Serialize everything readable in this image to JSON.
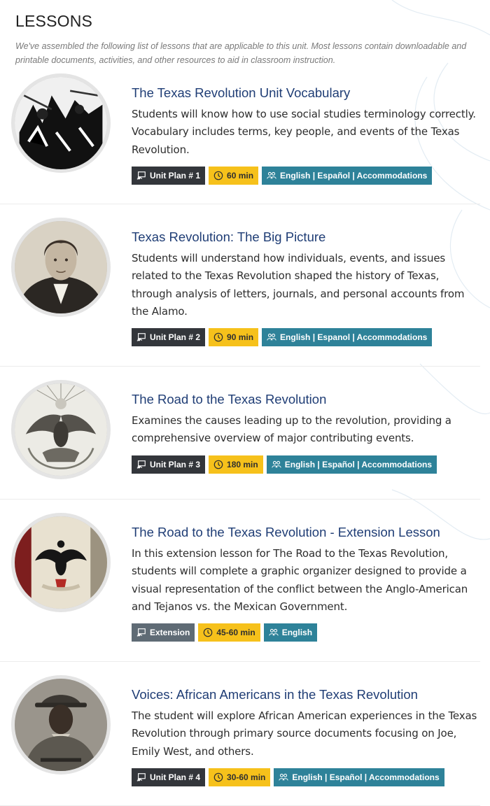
{
  "header": {
    "title": "LESSONS",
    "intro": "We've assembled the following list of lessons that are applicable to this unit. Most lessons contain downloadable and printable documents, activities, and other resources to aid in classroom instruction."
  },
  "lessons": [
    {
      "title": "The Texas Revolution Unit Vocabulary",
      "description": "Students will know how to use social studies terminology correctly. Vocabulary includes terms, key people, and events of the Texas Revolution.",
      "plan": "Unit Plan # 1",
      "duration": "60 min",
      "languages": "English | Español | Accommodations",
      "image_icon": "battle-engraving-image"
    },
    {
      "title": "Texas Revolution: The Big Picture",
      "description": "Students will understand how individuals, events, and issues related to the Texas Revolution shaped the history of Texas, through analysis of letters, journals, and personal accounts from the Alamo.",
      "plan": "Unit Plan # 2",
      "duration": "90 min",
      "languages": "English | Espanol | Accommodations",
      "image_icon": "portrait-engraving-image"
    },
    {
      "title": "The Road to the Texas Revolution",
      "description": "Examines the causes leading up to the revolution, providing a comprehensive overview of major contributing events.",
      "plan": "Unit Plan # 3",
      "duration": "180 min",
      "languages": "English | Español | Accommodations",
      "image_icon": "mexican-eagle-seal-image"
    },
    {
      "title": "The Road to the Texas Revolution - Extension Lesson",
      "description": "In this extension lesson for The Road to the Texas Revolution, students will complete a graphic organizer designed to provide a visual representation of the conflict between the Anglo-American and Tejanos vs. the Mexican Government.",
      "plan": "Extension",
      "duration": "45-60 min",
      "languages": "English",
      "image_icon": "eagle-flag-image"
    },
    {
      "title": "Voices: African Americans in the Texas Revolution",
      "description": "The student will explore African American experiences in the Texas Revolution through primary source documents focusing on Joe, Emily West, and others.",
      "plan": "Unit Plan # 4",
      "duration": "30-60 min",
      "languages": "English | Español | Accommodations",
      "image_icon": "soldier-portrait-image"
    }
  ],
  "colors": {
    "title": "#1f3d75",
    "tag_dark": "#33363b",
    "tag_gray": "#5f6b75",
    "tag_yellow": "#f6c11b",
    "tag_teal": "#2e8299"
  }
}
